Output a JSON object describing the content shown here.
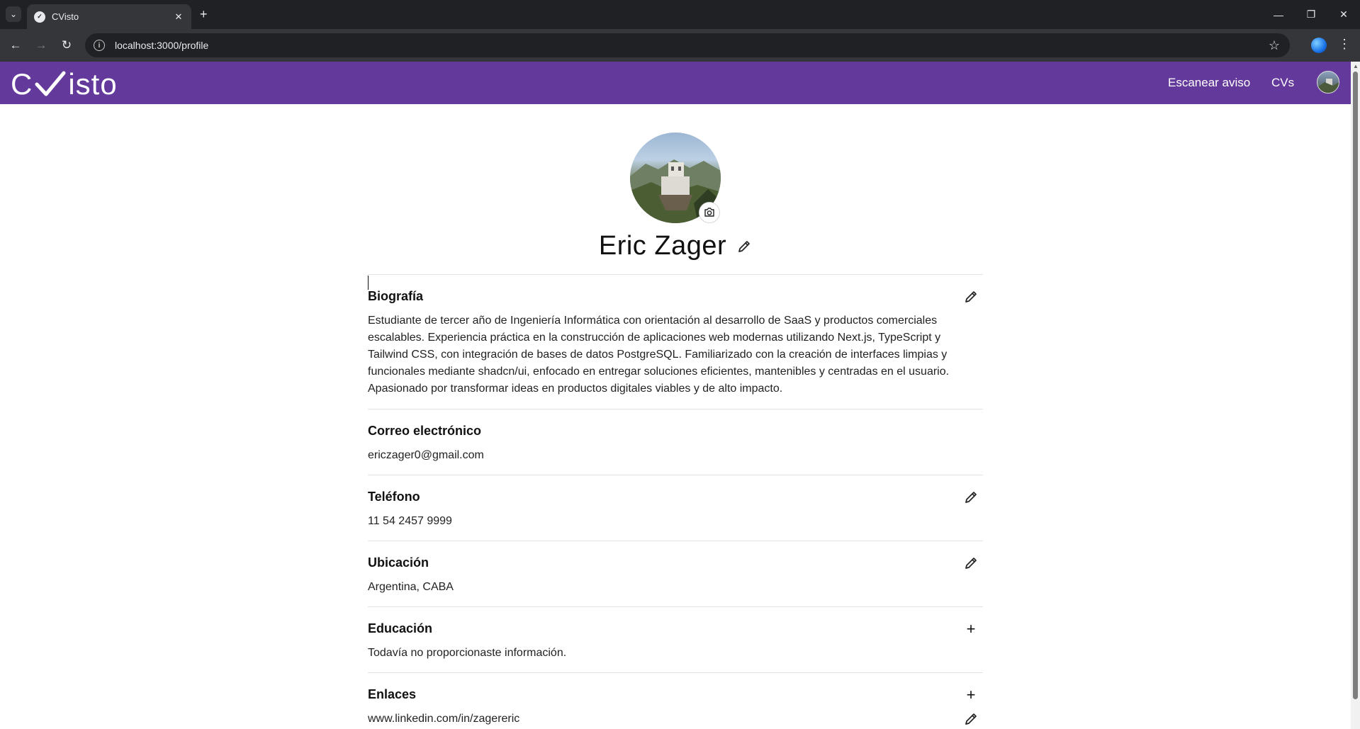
{
  "browser": {
    "tab_title": "CVisto",
    "url": "localhost:3000/profile",
    "new_tab_symbol": "+",
    "tab_close_symbol": "✕",
    "tab_list_symbol": "⌄",
    "back_symbol": "←",
    "forward_symbol": "→",
    "reload_symbol": "↻",
    "star_symbol": "☆",
    "menu_symbol": "⋮",
    "minimize_symbol": "—",
    "restore_symbol": "❐",
    "close_symbol": "✕"
  },
  "app": {
    "logo_left": "C",
    "logo_right": "isto",
    "nav": {
      "scan": "Escanear aviso",
      "cvs": "CVs"
    },
    "colors": {
      "header_bg": "#64399c",
      "text": "#1a1a1a"
    }
  },
  "profile": {
    "name": "Eric Zager",
    "sections": {
      "bio": {
        "title": "Biografía",
        "text": "Estudiante de tercer año de Ingeniería Informática con orientación al desarrollo de SaaS y productos comerciales escalables. Experiencia práctica en la construcción de aplicaciones web modernas utilizando Next.js, TypeScript y Tailwind CSS, con integración de bases de datos PostgreSQL. Familiarizado con la creación de interfaces limpias y funcionales mediante shadcn/ui, enfocado en entregar soluciones eficientes, mantenibles y centradas en el usuario. Apasionado por transformar ideas en productos digitales viables y de alto impacto."
      },
      "email": {
        "title": "Correo electrónico",
        "value": "ericzager0@gmail.com"
      },
      "phone": {
        "title": "Teléfono",
        "value": "11 54 2457 9999"
      },
      "location": {
        "title": "Ubicación",
        "value": "Argentina, CABA"
      },
      "education": {
        "title": "Educación",
        "value": "Todavía no proporcionaste información.",
        "add_symbol": "+"
      },
      "links": {
        "title": "Enlaces",
        "items": [
          "www.linkedin.com/in/zagereric"
        ],
        "add_symbol": "+"
      }
    }
  }
}
